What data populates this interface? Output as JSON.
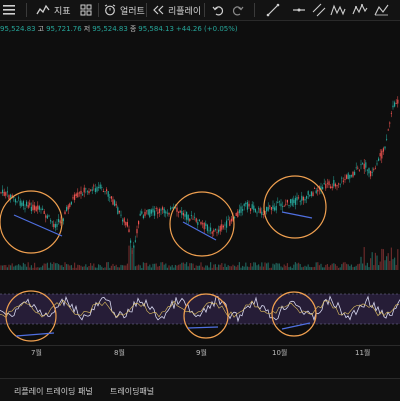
{
  "toolbar": {
    "indicators_label": "지표",
    "alert_label": "얼러트",
    "replay_label": "리플레이"
  },
  "ohlc": {
    "open_value": "95,524.83",
    "high_label": "고",
    "high_value": "95,721.76",
    "low_label": "저",
    "low_value": "95,524.83",
    "close_label": "종",
    "close_value": "95,584.13",
    "change": "+44.26 (+0.05%)"
  },
  "xaxis": {
    "labels": [
      "7월",
      "8월",
      "9월",
      "10월",
      "11월"
    ]
  },
  "bottom_panel": {
    "tab1": "리플레이 트레이딩 패널",
    "tab2": "트레이딩패널"
  },
  "colors": {
    "up": "#26a69a",
    "down": "#ef5350",
    "circle": "#f0a050",
    "divergence_line": "#4f6fe0",
    "rsi_line": "#d8d8f0",
    "rsi_band": "#3a2a5a"
  }
}
